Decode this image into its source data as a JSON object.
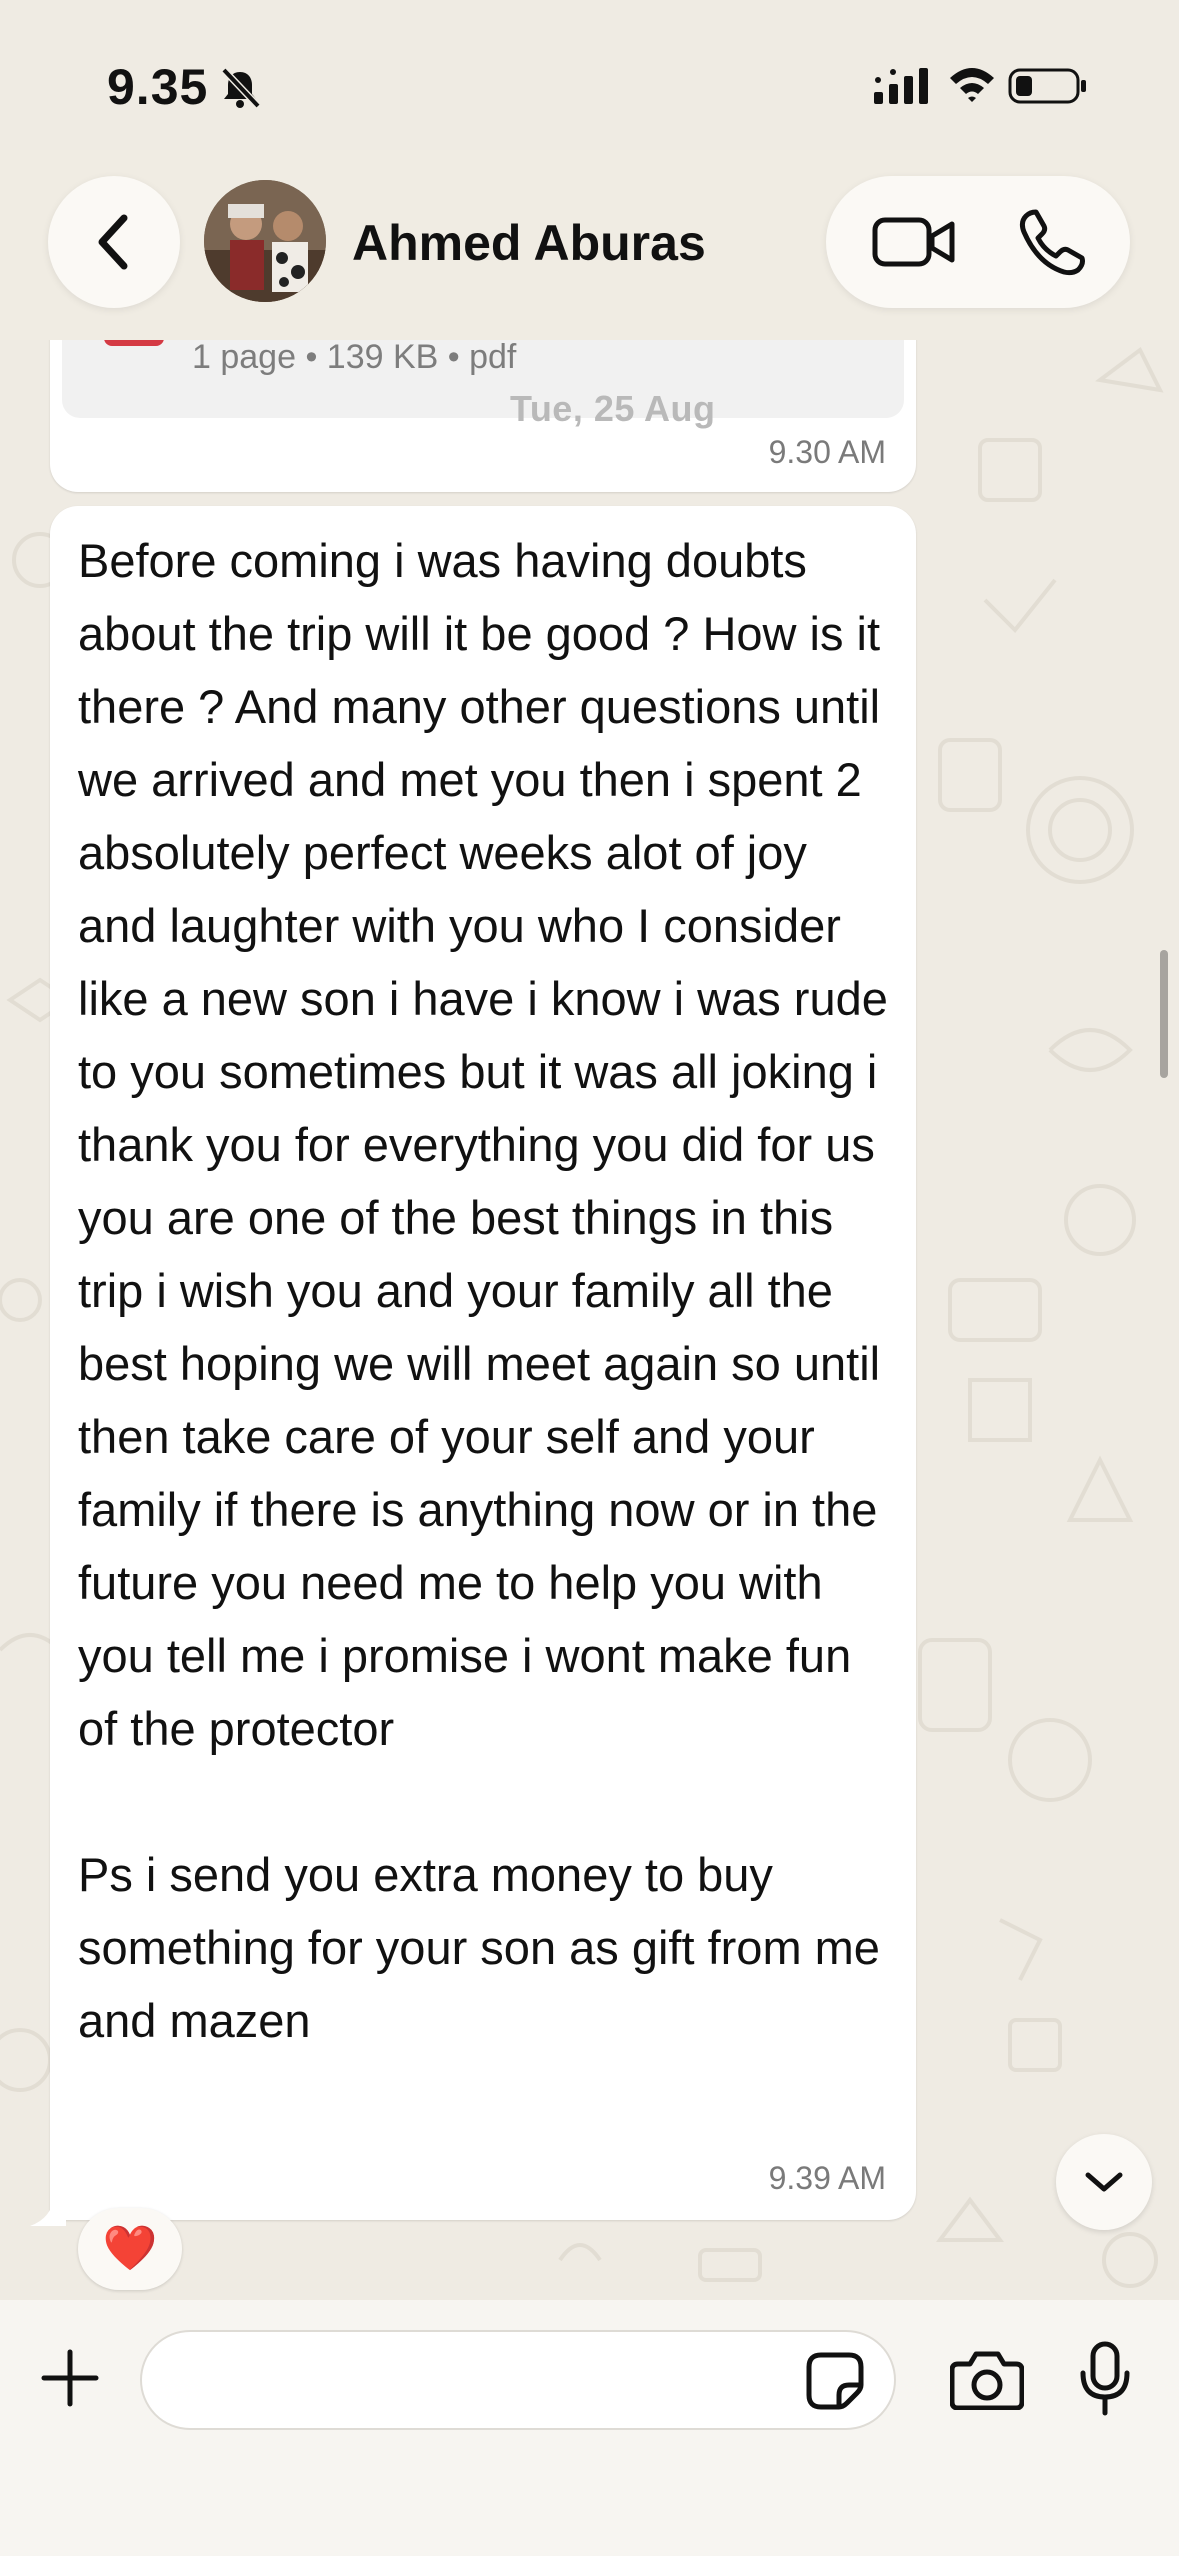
{
  "status_bar": {
    "time": "9.35",
    "icons": [
      "bell-slash-icon",
      "cellular-signal-icon",
      "wifi-icon",
      "battery-low-icon"
    ]
  },
  "header": {
    "contact_name": "Ahmed Aburas",
    "icons": [
      "chevron-left-icon",
      "video-camera-icon",
      "phone-icon"
    ]
  },
  "messages": [
    {
      "type": "document",
      "meta": "1 page • 139 KB • pdf",
      "time": "9.30 AM"
    },
    {
      "type": "text",
      "text": "Before coming i was having doubts about the trip will it be good ? How is it there ? And many other questions until we arrived and met you then i spent 2 absolutely perfect weeks alot of joy and laughter with you who I consider like a new son i have i know i was rude to you sometimes but it was all joking i thank you for everything you did for us you are one of the best things in this trip i wish you and your family all the best hoping we will meet again so until then take care of your self and your family if there is anything now or in the future you need me to help you with you tell me i promise i wont make fun of the protector\n\nPs i send you extra money to buy something for your son as gift from me and mazen",
      "time": "9.39 AM",
      "reaction": "❤️"
    }
  ],
  "date_separator": "Tue, 25 Aug",
  "composer": {
    "input_value": "",
    "icons": [
      "plus-icon",
      "sticker-icon",
      "camera-icon",
      "microphone-icon"
    ]
  },
  "colors": {
    "background": "#efebe3",
    "bubble": "#ffffff",
    "heart": "#e0242c",
    "document_accent": "#d43a44"
  }
}
